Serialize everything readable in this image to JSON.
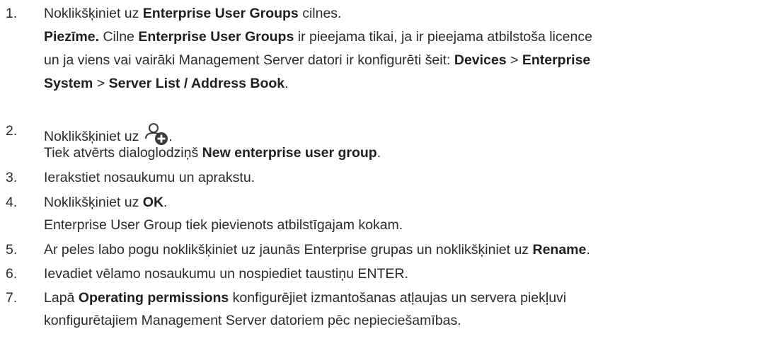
{
  "steps": [
    {
      "number": "1.",
      "lines": [
        {
          "pre": "Noklikšķiniet uz ",
          "b1": "Enterprise User Groups",
          "post": " cilnes."
        },
        {
          "b1": "Piezīme.",
          "t1": " Cilne ",
          "b2": "Enterprise User Groups",
          "t2": " ir pieejama tikai, ja ir pieejama atbilstoša licence"
        },
        {
          "t1": "un ja viens vai vairāki Management Server datori ir konfigurēti šeit:  ",
          "b1": "Devices",
          "t2": " > ",
          "b2": "Enterprise"
        },
        {
          "b1": "System",
          "t1": " > ",
          "b2": "Server List / Address Book",
          "t2": "."
        }
      ]
    },
    {
      "number": "2.",
      "lines": [
        {
          "pre": "Noklikšķiniet uz",
          "icon": "add-user-icon",
          "post": "."
        },
        {
          "pre": "Tiek atvērts dialoglodziņš ",
          "b1": "New enterprise user group",
          "post": "."
        }
      ]
    },
    {
      "number": "3.",
      "lines": [
        {
          "pre": "Ierakstiet nosaukumu un aprakstu."
        }
      ]
    },
    {
      "number": "4.",
      "lines": [
        {
          "pre": "Noklikšķiniet uz ",
          "b1": "OK",
          "post": "."
        },
        {
          "pre": "Enterprise User Group tiek pievienots atbilstīgajam kokam."
        }
      ]
    },
    {
      "number": "5.",
      "lines": [
        {
          "pre": "Ar peles labo pogu noklikšķiniet uz jaunās Enterprise grupas un noklikšķiniet uz ",
          "b1": "Rename",
          "post": "."
        }
      ]
    },
    {
      "number": "6.",
      "lines": [
        {
          "pre": "Ievadiet vēlamo nosaukumu un nospiediet taustiņu ENTER."
        }
      ]
    },
    {
      "number": "7.",
      "lines": [
        {
          "pre": "Lapā ",
          "b1": "Operating permissions",
          "post": " konfigurējiet izmantošanas atļaujas un servera piekļuvi"
        },
        {
          "pre": "konfigurētajiem Management Server datoriem pēc nepieciešamības."
        }
      ]
    }
  ],
  "colors": {
    "text": "#2b2b2b",
    "bold": "#1f1f1f",
    "icon": "#3a3a3a"
  }
}
